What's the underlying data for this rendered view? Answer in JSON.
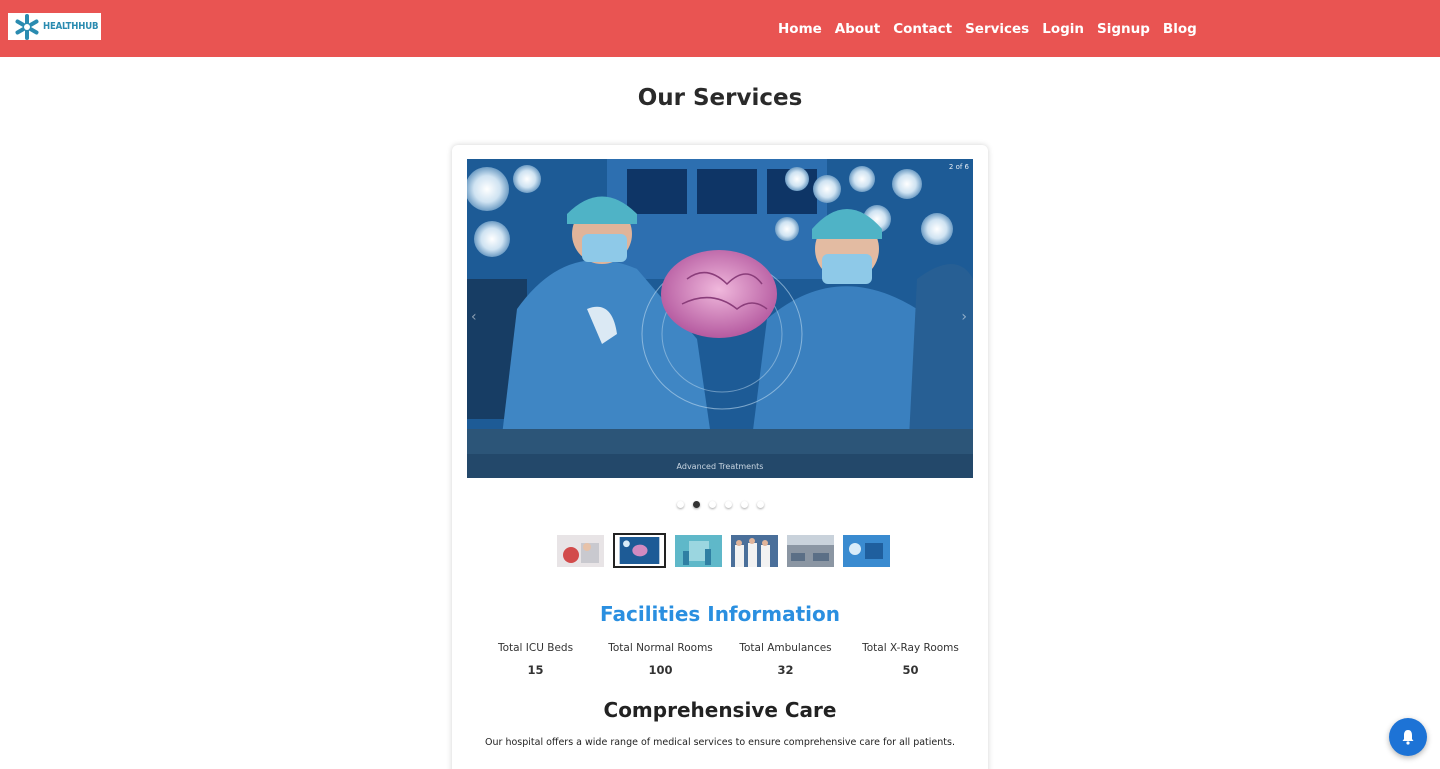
{
  "brand": {
    "logo_text": "HEALTHHUB"
  },
  "nav": {
    "items": [
      {
        "label": "Home"
      },
      {
        "label": "About"
      },
      {
        "label": "Contact"
      },
      {
        "label": "Services"
      },
      {
        "label": "Login"
      },
      {
        "label": "Signup"
      },
      {
        "label": "Blog"
      }
    ]
  },
  "page": {
    "title": "Our Services"
  },
  "carousel": {
    "counter": "2 of 6",
    "caption": "Advanced Treatments",
    "slide_count": 6,
    "active_index": 2,
    "prev_icon": "chevron-left-icon",
    "next_icon": "chevron-right-icon"
  },
  "facilities": {
    "title": "Facilities Information",
    "stats": [
      {
        "label": "Total ICU Beds",
        "value": "15"
      },
      {
        "label": "Total Normal Rooms",
        "value": "100"
      },
      {
        "label": "Total Ambulances",
        "value": "32"
      },
      {
        "label": "Total X-Ray Rooms",
        "value": "50"
      }
    ]
  },
  "care": {
    "title": "Comprehensive Care",
    "text": "Our hospital offers a wide range of medical services to ensure comprehensive care for all patients."
  },
  "colors": {
    "header": "#e95452",
    "accent": "#2a8fe0",
    "notify_button": "#1d73d6"
  },
  "notify": {
    "icon": "bell-icon"
  }
}
